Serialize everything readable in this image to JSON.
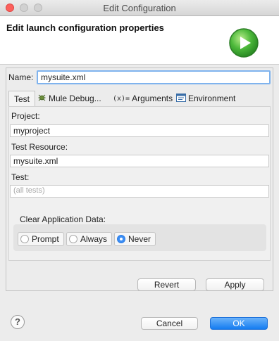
{
  "window": {
    "title": "Edit Configuration"
  },
  "header": {
    "title": "Edit launch configuration properties",
    "icon": "run-launch-icon"
  },
  "name": {
    "label": "Name:",
    "value": "mysuite.xml"
  },
  "tabs": [
    {
      "label": "Test",
      "active": true
    },
    {
      "label": "Mule Debug...",
      "icon": "bug-icon"
    },
    {
      "label": "Arguments",
      "icon": "arguments-icon"
    },
    {
      "label": "Environment",
      "icon": "environment-icon"
    }
  ],
  "form": {
    "project_label": "Project:",
    "project_value": "myproject",
    "resource_label": "Test Resource:",
    "resource_value": "mysuite.xml",
    "test_label": "Test:",
    "test_placeholder": "(all tests)"
  },
  "clear_data": {
    "label": "Clear Application Data:",
    "options": [
      "Prompt",
      "Always",
      "Never"
    ],
    "selected": "Never"
  },
  "buttons": {
    "revert": "Revert",
    "apply": "Apply",
    "cancel": "Cancel",
    "ok": "OK",
    "help": "?"
  },
  "colors": {
    "accent": "#147cf1",
    "run_icon_green": "#3aa935"
  }
}
